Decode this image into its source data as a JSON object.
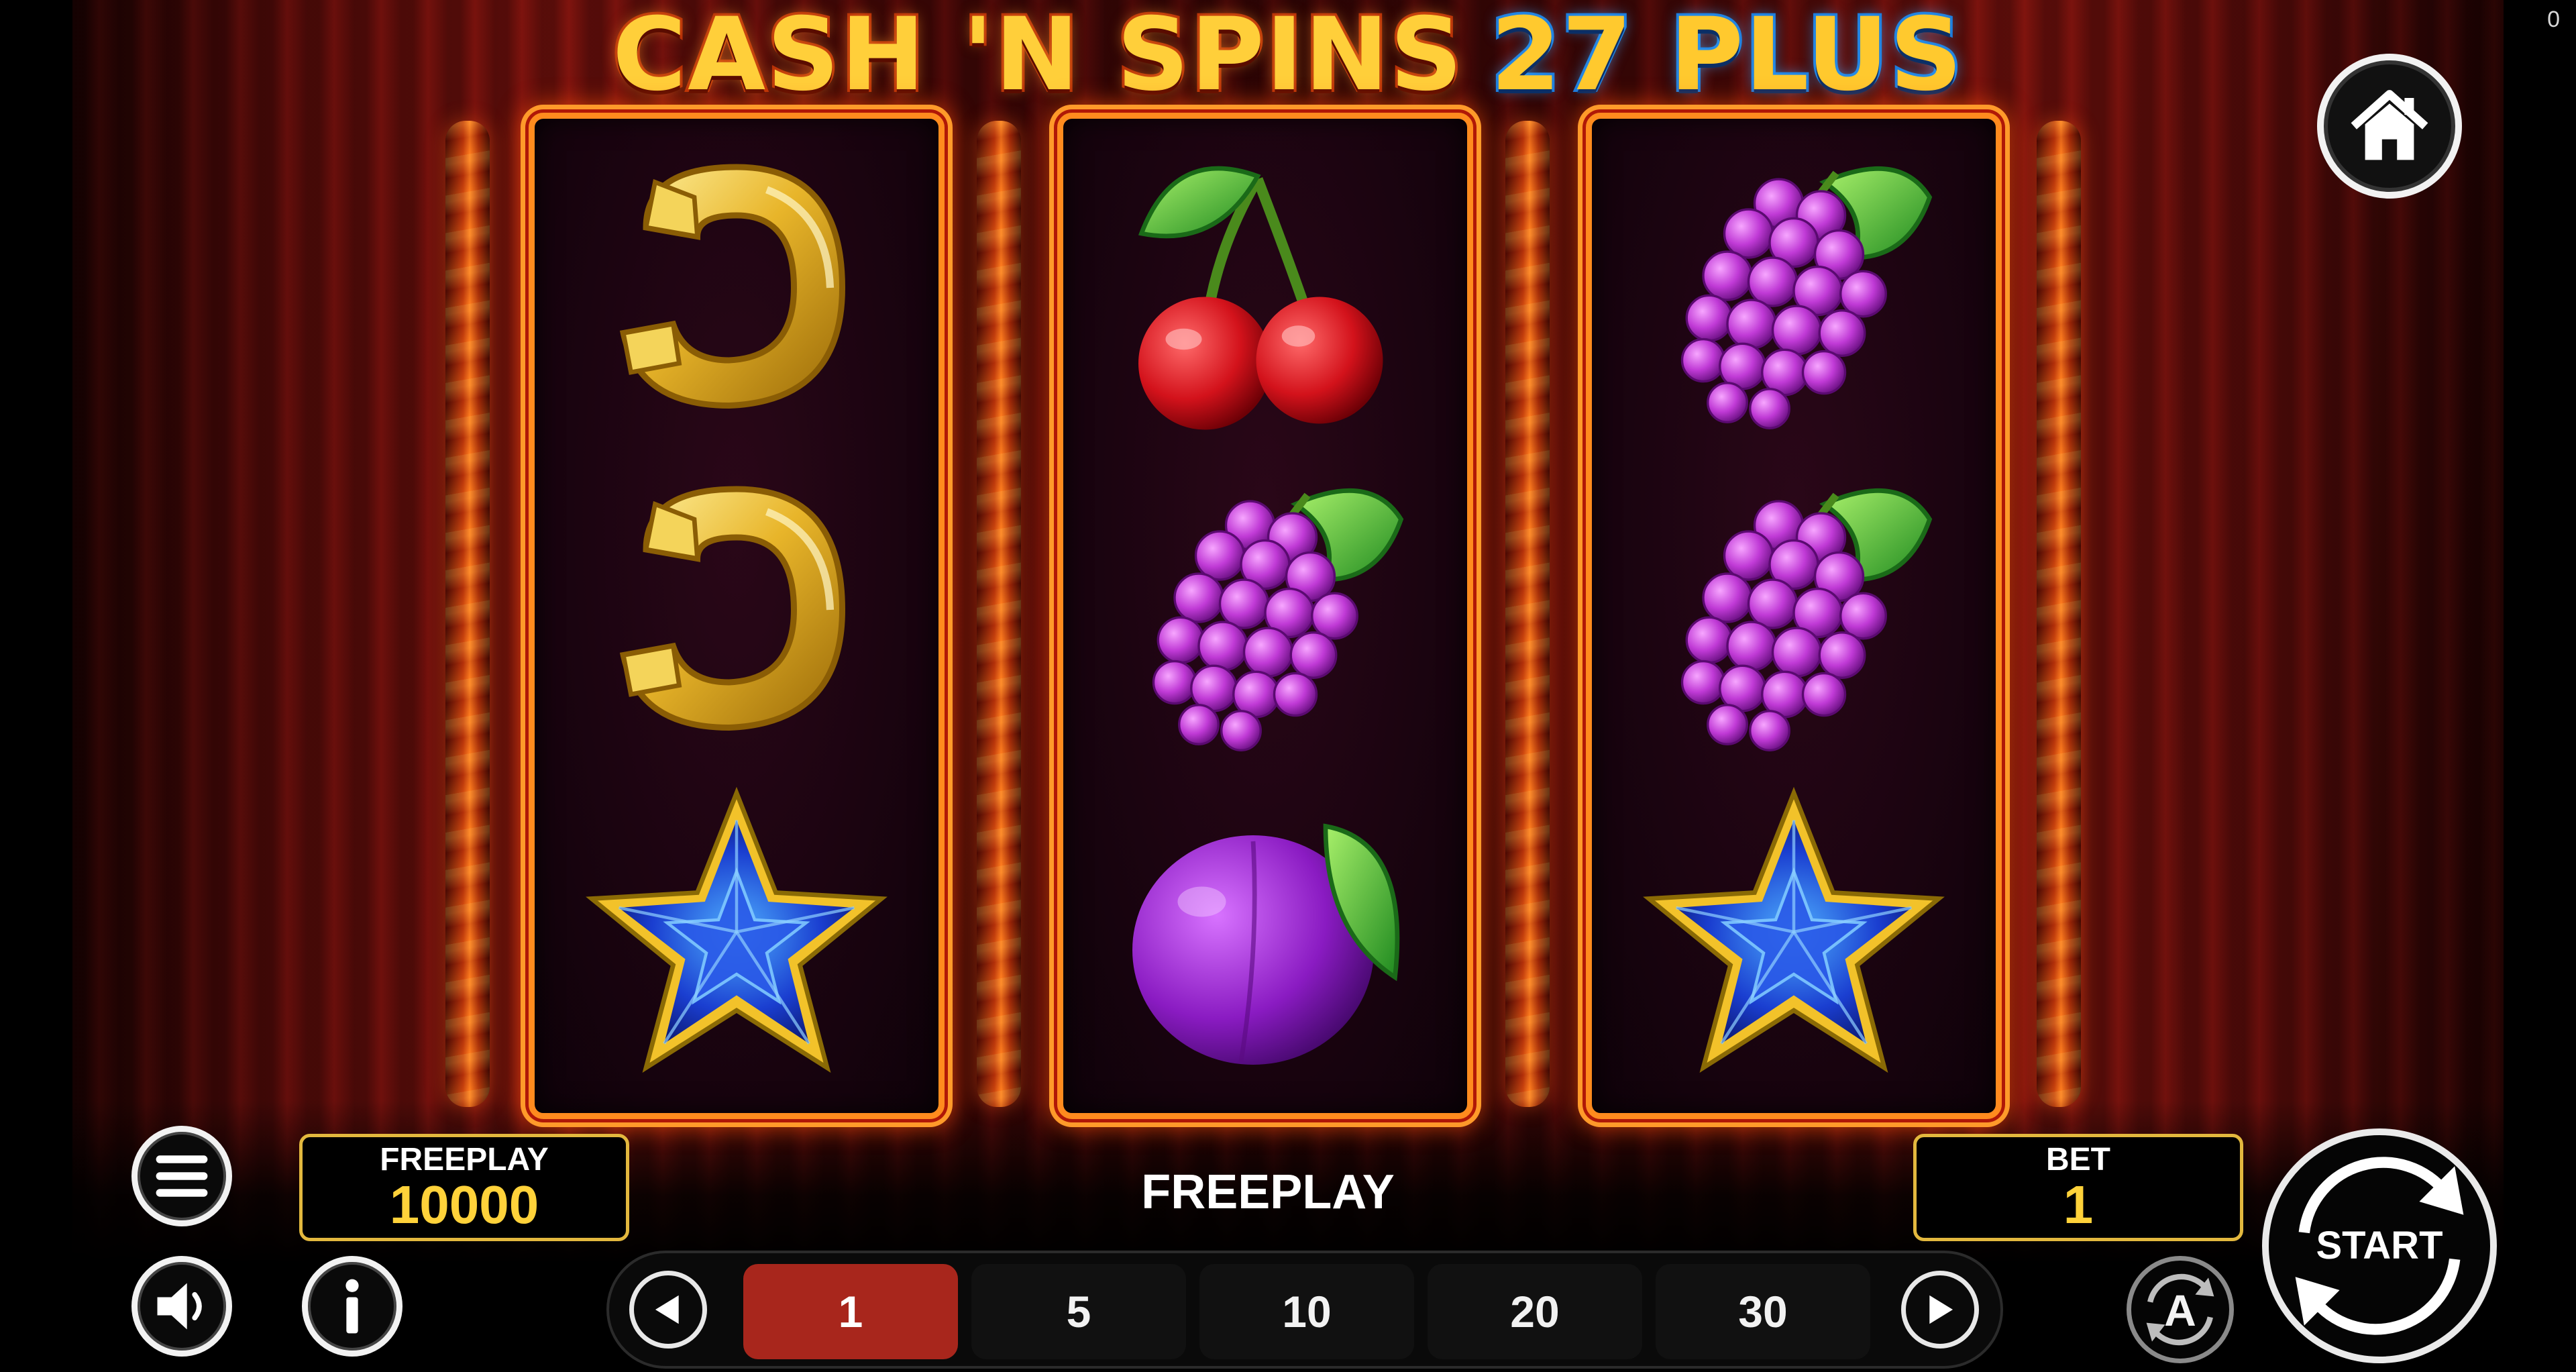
{
  "game": {
    "title_main": "CASH 'N SPINS",
    "title_accent": "27 PLUS",
    "corner_counter": "0"
  },
  "reels": [
    [
      "horseshoe",
      "horseshoe",
      "star"
    ],
    [
      "cherry",
      "grapes",
      "plum"
    ],
    [
      "grapes",
      "grapes",
      "star"
    ]
  ],
  "balance": {
    "label": "FREEPLAY",
    "value": "10000"
  },
  "status_text": "FREEPLAY",
  "bet": {
    "label": "BET",
    "value": "1"
  },
  "bet_options": [
    "1",
    "5",
    "10",
    "20",
    "30"
  ],
  "selected_bet_option": "1",
  "controls": {
    "start_label": "START",
    "autoplay_label": "A",
    "menu_icon": "hamburger-menu-icon",
    "sound_icon": "speaker-icon",
    "info_icon": "info-icon",
    "home_icon": "home-icon"
  },
  "colors": {
    "frame": "#ff8b1e",
    "gold_text": "#ffd23a",
    "selected_bet": "#a8261c",
    "box_border": "#e3b83e"
  }
}
